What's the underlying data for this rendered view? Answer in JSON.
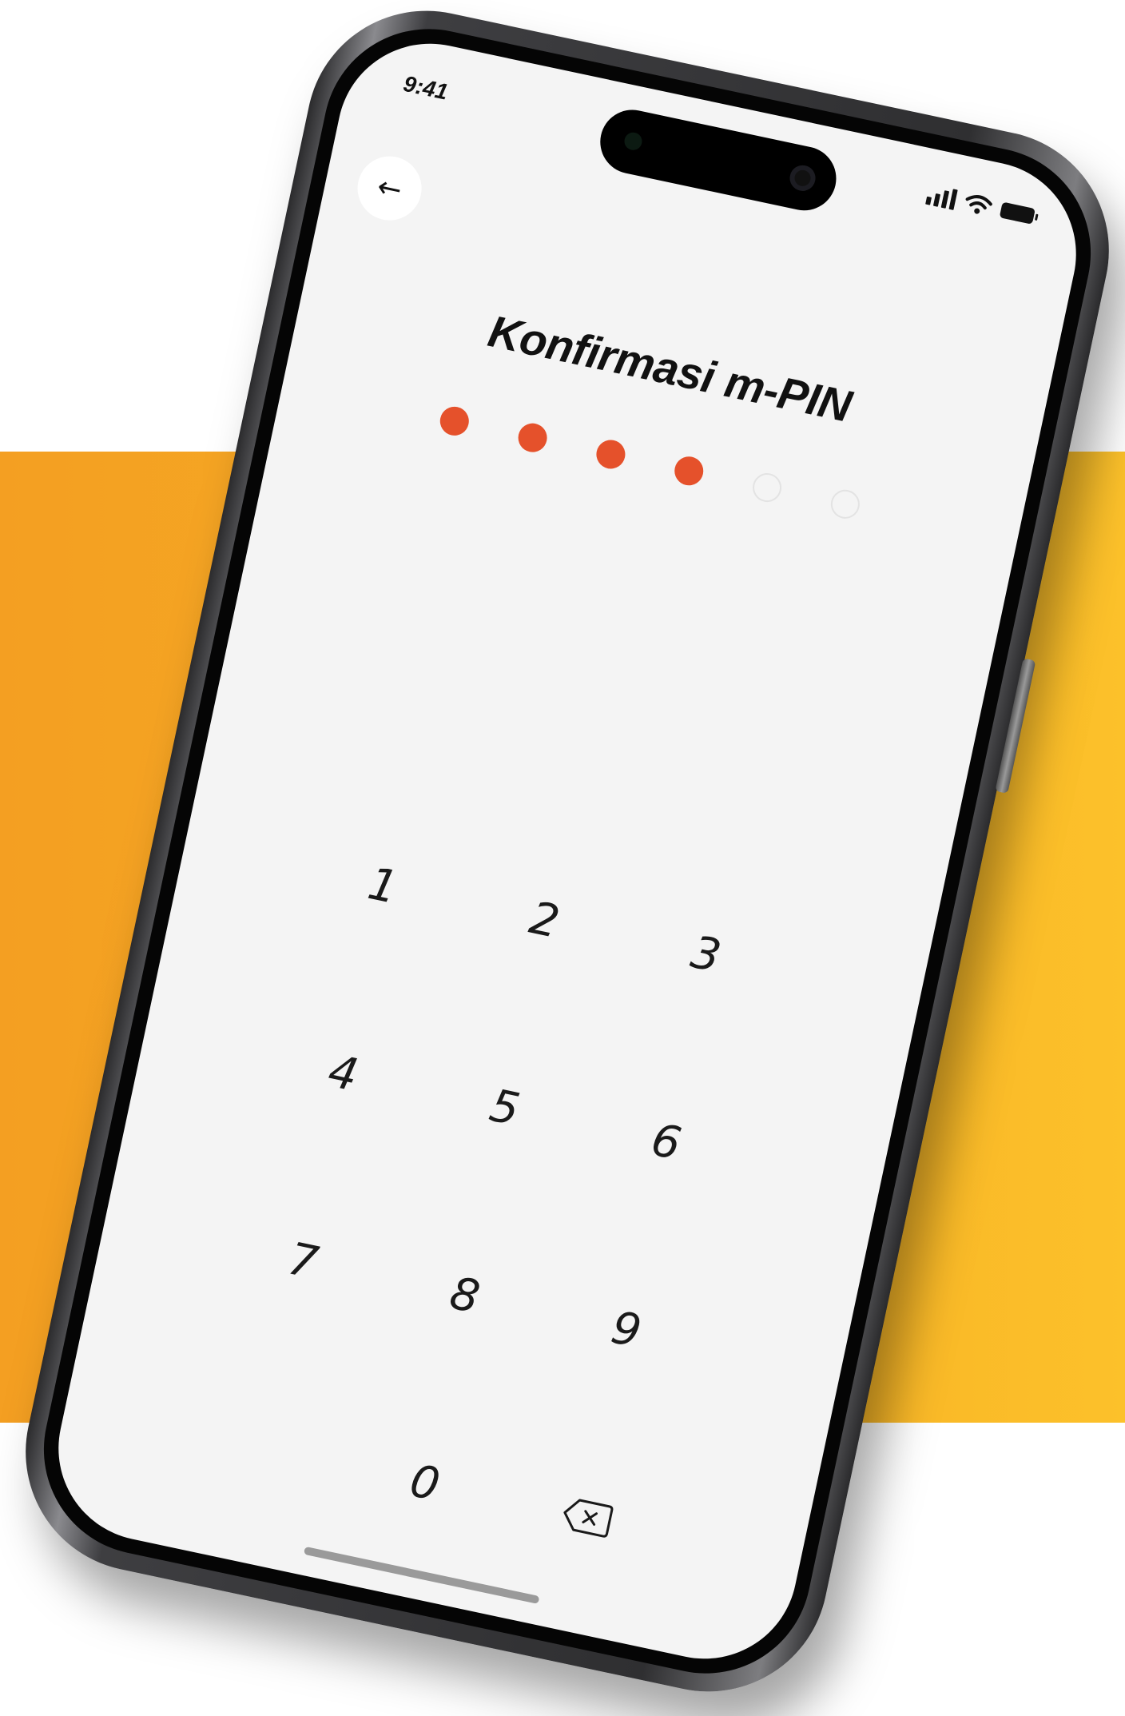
{
  "status_bar": {
    "time": "9:41"
  },
  "header": {
    "back_icon": "arrow-left-icon",
    "back_glyph": "←",
    "title": "Konfirmasi m-PIN"
  },
  "pin": {
    "length": 6,
    "filled": 4,
    "filled_color": "#e5512b"
  },
  "keypad": {
    "keys": [
      "1",
      "2",
      "3",
      "4",
      "5",
      "6",
      "7",
      "8",
      "9",
      "",
      "0",
      "⌫"
    ],
    "backspace_icon": "backspace-icon"
  },
  "colors": {
    "accent": "#e5512b",
    "background_band": "#f6ac24"
  }
}
